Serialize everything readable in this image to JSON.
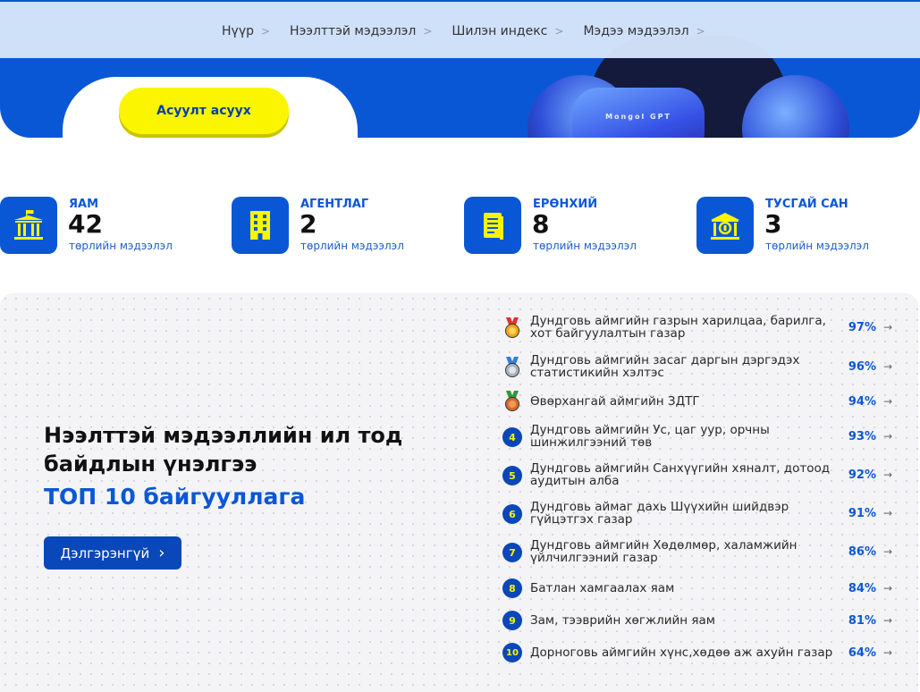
{
  "breadcrumb": [
    "Нүүр",
    "Нээлттэй мэдээлэл",
    "Шилэн индекс",
    "Мэдээ мэдээлэл"
  ],
  "hero": {
    "ask_button": "Асуулт асуух",
    "robot_label": "Mongol GPT"
  },
  "stats": [
    {
      "title": "ЯАМ",
      "value": "42",
      "subtitle": "төрлийн мэдээлэл",
      "icon": "ministry-building-icon"
    },
    {
      "title": "АГЕНТЛАГ",
      "value": "2",
      "subtitle": "төрлийн мэдээлэл",
      "icon": "office-building-icon"
    },
    {
      "title": "ЕРӨНХИЙ",
      "value": "8",
      "subtitle": "төрлийн мэдээлэл",
      "icon": "document-icon"
    },
    {
      "title": "ТУСГАЙ САН",
      "value": "3",
      "subtitle": "төрлийн мэдээлэл",
      "icon": "fund-bank-icon"
    }
  ],
  "ranking": {
    "title": "Нээлттэй мэдээллийн ил тод байдлын үнэлгээ",
    "subtitle": "ТОП 10 байгууллага",
    "more_button": "Дэлгэрэнгүй",
    "items": [
      {
        "rank": "1",
        "name": "Дундговь аймгийн газрын харилцаа, барилга, хот байгуулалтын газар",
        "score": "97",
        "unit": "%",
        "badge": "gold-medal-icon"
      },
      {
        "rank": "2",
        "name": "Дундговь аймгийн засаг даргын дэргэдэх статистикийн хэлтэс",
        "score": "96",
        "unit": "%",
        "badge": "silver-medal-icon"
      },
      {
        "rank": "3",
        "name": "Өвөрхангай аймгийн ЗДТГ",
        "score": "94",
        "unit": "%",
        "badge": "bronze-medal-icon"
      },
      {
        "rank": "4",
        "name": "Дундговь аймгийн Ус, цаг уур, орчны шинжилгээний төв",
        "score": "93",
        "unit": "%"
      },
      {
        "rank": "5",
        "name": "Дундговь аймгийн Санхүүгийн хяналт, дотоод аудитын алба",
        "score": "92",
        "unit": "%"
      },
      {
        "rank": "6",
        "name": "Дундговь аймаг дахь Шүүхийн шийдвэр гүйцэтгэх газар",
        "score": "91",
        "unit": "%"
      },
      {
        "rank": "7",
        "name": "Дундговь аймгийн Хөдөлмөр, халамжийн үйлчилгээний газар",
        "score": "86",
        "unit": "%"
      },
      {
        "rank": "8",
        "name": "Батлан хамгаалах яам",
        "score": "84",
        "unit": "%"
      },
      {
        "rank": "9",
        "name": "Зам, тээврийн хөгжлийн яам",
        "score": "81",
        "unit": "%"
      },
      {
        "rank": "10",
        "name": "Дорноговь аймгийн хүнс,хөдөө аж ахуйн газар",
        "score": "64",
        "unit": "%"
      }
    ]
  },
  "colors": {
    "brand_blue": "#0a57d6",
    "accent_yellow": "#fbf500",
    "navy": "#0a47b8"
  }
}
